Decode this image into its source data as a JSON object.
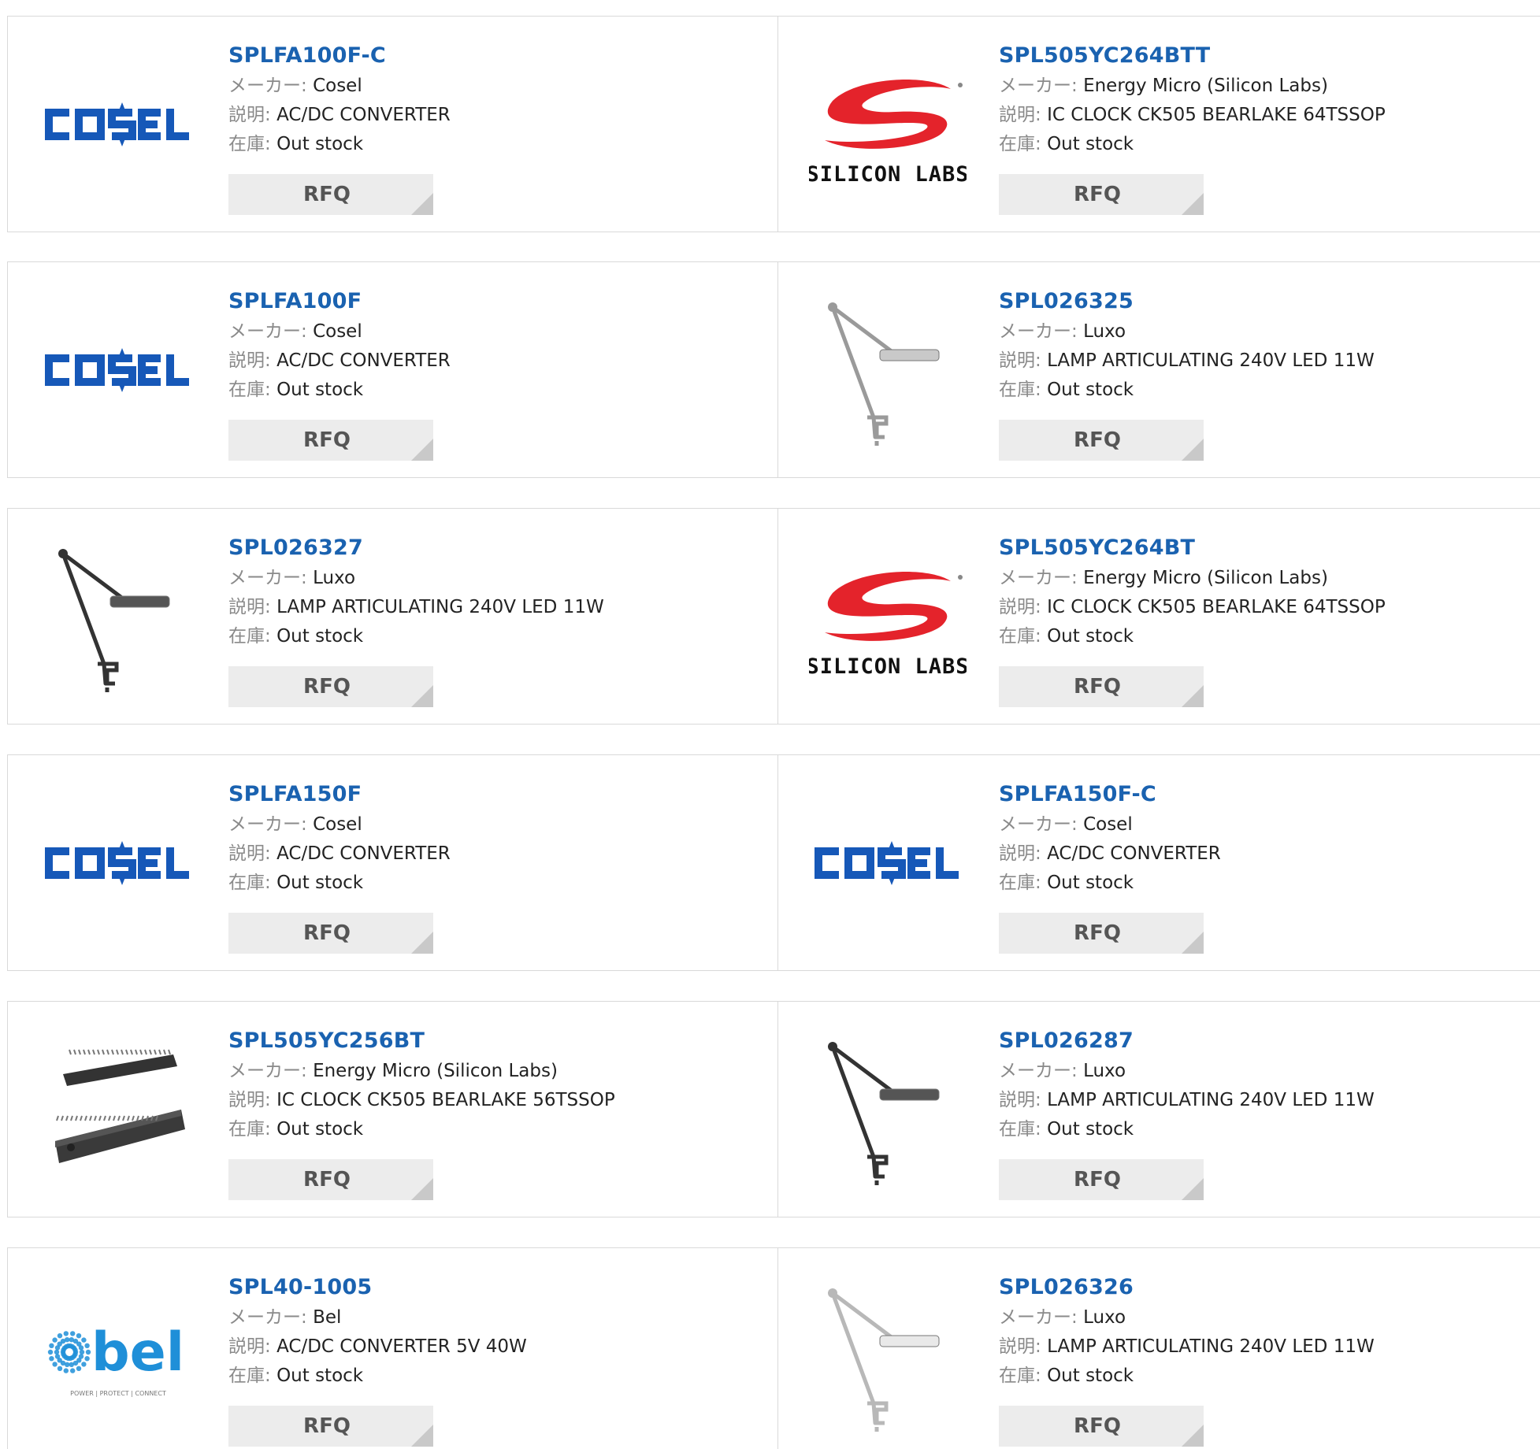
{
  "labels": {
    "maker": "メーカー:",
    "desc": "説明:",
    "stock": "在庫:"
  },
  "rfq_label": "RFQ",
  "products": [
    {
      "part": "SPLFA100F-C",
      "maker": "Cosel",
      "desc": "AC/DC CONVERTER",
      "stock": "Out stock",
      "image": "cosel-logo"
    },
    {
      "part": "SPL505YC264BTT",
      "maker": "Energy Micro (Silicon Labs)",
      "desc": "IC CLOCK CK505 BEARLAKE 64TSSOP",
      "stock": "Out stock",
      "image": "silicon-labs-logo",
      "logo_text": "SILICON LABS"
    },
    {
      "part": "SPLFA100F",
      "maker": "Cosel",
      "desc": "AC/DC CONVERTER",
      "stock": "Out stock",
      "image": "cosel-logo"
    },
    {
      "part": "SPL026325",
      "maker": "Luxo",
      "desc": "LAMP ARTICULATING 240V LED 11W",
      "stock": "Out stock",
      "image": "lamp-photo-light"
    },
    {
      "part": "SPL026327",
      "maker": "Luxo",
      "desc": "LAMP ARTICULATING 240V LED 11W",
      "stock": "Out stock",
      "image": "lamp-photo-dark"
    },
    {
      "part": "SPL505YC264BT",
      "maker": "Energy Micro (Silicon Labs)",
      "desc": "IC CLOCK CK505 BEARLAKE 64TSSOP",
      "stock": "Out stock",
      "image": "silicon-labs-logo",
      "logo_text": "SILICON LABS"
    },
    {
      "part": "SPLFA150F",
      "maker": "Cosel",
      "desc": "AC/DC CONVERTER",
      "stock": "Out stock",
      "image": "cosel-logo"
    },
    {
      "part": "SPLFA150F-C",
      "maker": "Cosel",
      "desc": "AC/DC CONVERTER",
      "stock": "Out stock",
      "image": "cosel-logo"
    },
    {
      "part": "SPL505YC256BT",
      "maker": "Energy Micro (Silicon Labs)",
      "desc": "IC CLOCK CK505 BEARLAKE 56TSSOP",
      "stock": "Out stock",
      "image": "tssop-chip-photo"
    },
    {
      "part": "SPL026287",
      "maker": "Luxo",
      "desc": "LAMP ARTICULATING 240V LED 11W",
      "stock": "Out stock",
      "image": "lamp-photo-dark"
    },
    {
      "part": "SPL40-1005",
      "maker": "Bel",
      "desc": "AC/DC CONVERTER 5V 40W",
      "stock": "Out stock",
      "image": "bel-logo",
      "logo_text": "bel",
      "logo_tagline": "POWER | PROTECT | CONNECT"
    },
    {
      "part": "SPL026326",
      "maker": "Luxo",
      "desc": "LAMP ARTICULATING 240V LED 11W",
      "stock": "Out stock",
      "image": "lamp-photo-white"
    }
  ],
  "colors": {
    "link": "#1a62b0",
    "cosel_blue": "#1658b8",
    "silicon_red": "#e4232b",
    "bel_blue": "#1f8fd8",
    "border": "#d9d9d9",
    "button_bg": "#ececec"
  }
}
